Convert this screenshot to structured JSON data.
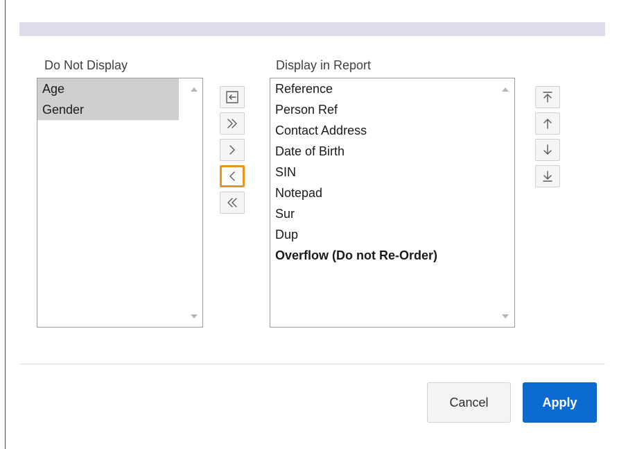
{
  "left_list": {
    "label": "Do Not Display",
    "items": [
      {
        "label": "Age",
        "selected": true
      },
      {
        "label": "Gender",
        "selected": true
      }
    ]
  },
  "right_list": {
    "label": "Display in Report",
    "items": [
      {
        "label": "Reference",
        "bold": false
      },
      {
        "label": "Person Ref",
        "bold": false
      },
      {
        "label": "Contact Address",
        "bold": false
      },
      {
        "label": "Date of Birth",
        "bold": false
      },
      {
        "label": "SIN",
        "bold": false
      },
      {
        "label": "Notepad",
        "bold": false
      },
      {
        "label": "Sur",
        "bold": false
      },
      {
        "label": "Dup",
        "bold": false
      },
      {
        "label": "Overflow (Do not Re-Order)",
        "bold": true
      }
    ]
  },
  "transfer_buttons": [
    {
      "name": "reset-button",
      "icon": "reset-icon"
    },
    {
      "name": "move-all-right-button",
      "icon": "double-chevron-right-icon"
    },
    {
      "name": "move-right-button",
      "icon": "chevron-right-icon"
    },
    {
      "name": "move-left-button",
      "icon": "chevron-left-icon",
      "focused": true
    },
    {
      "name": "move-all-left-button",
      "icon": "double-chevron-left-icon"
    }
  ],
  "order_buttons": [
    {
      "name": "move-top-button",
      "icon": "arrow-to-top-icon"
    },
    {
      "name": "move-up-button",
      "icon": "arrow-up-icon"
    },
    {
      "name": "move-down-button",
      "icon": "arrow-down-icon"
    },
    {
      "name": "move-bottom-button",
      "icon": "arrow-to-bottom-icon"
    }
  ],
  "footer": {
    "cancel_label": "Cancel",
    "apply_label": "Apply"
  },
  "colors": {
    "accent": "#0b6bd0",
    "focus": "#f0921e",
    "selected_bg": "#cfcfcf"
  }
}
